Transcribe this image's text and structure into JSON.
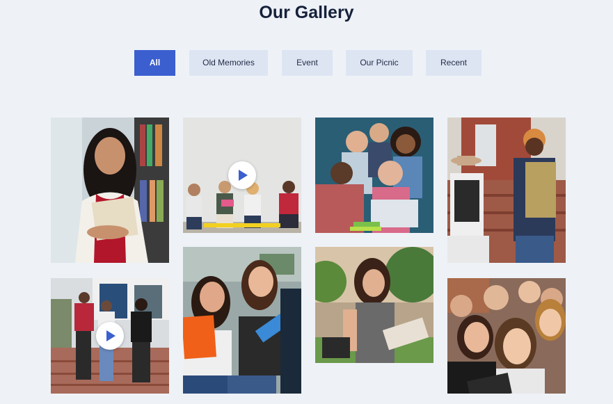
{
  "gallery": {
    "title": "Our Gallery"
  },
  "filters": [
    {
      "label": "All",
      "active": true
    },
    {
      "label": "Old Memories",
      "active": false
    },
    {
      "label": "Event",
      "active": false
    },
    {
      "label": "Our Picnic",
      "active": false
    },
    {
      "label": "Recent",
      "active": false
    }
  ],
  "colors": {
    "background": "#eef2f7",
    "accent": "#3b5fcf",
    "filter_inactive": "#dde5f3",
    "title": "#15213a"
  },
  "tiles": [
    {
      "name": "photo-student-holding-notebook-library",
      "video": false
    },
    {
      "name": "video-group-meeting-seated",
      "video": true
    },
    {
      "name": "photo-group-laptop-smiling",
      "video": false
    },
    {
      "name": "photo-two-students-backpacks-steps",
      "video": false
    },
    {
      "name": "video-students-walking-campus-stairs",
      "video": true
    },
    {
      "name": "photo-friends-laughing-folders",
      "video": false
    },
    {
      "name": "photo-student-writing-notes-outdoors",
      "video": false
    },
    {
      "name": "photo-group-selfie",
      "video": false
    }
  ]
}
